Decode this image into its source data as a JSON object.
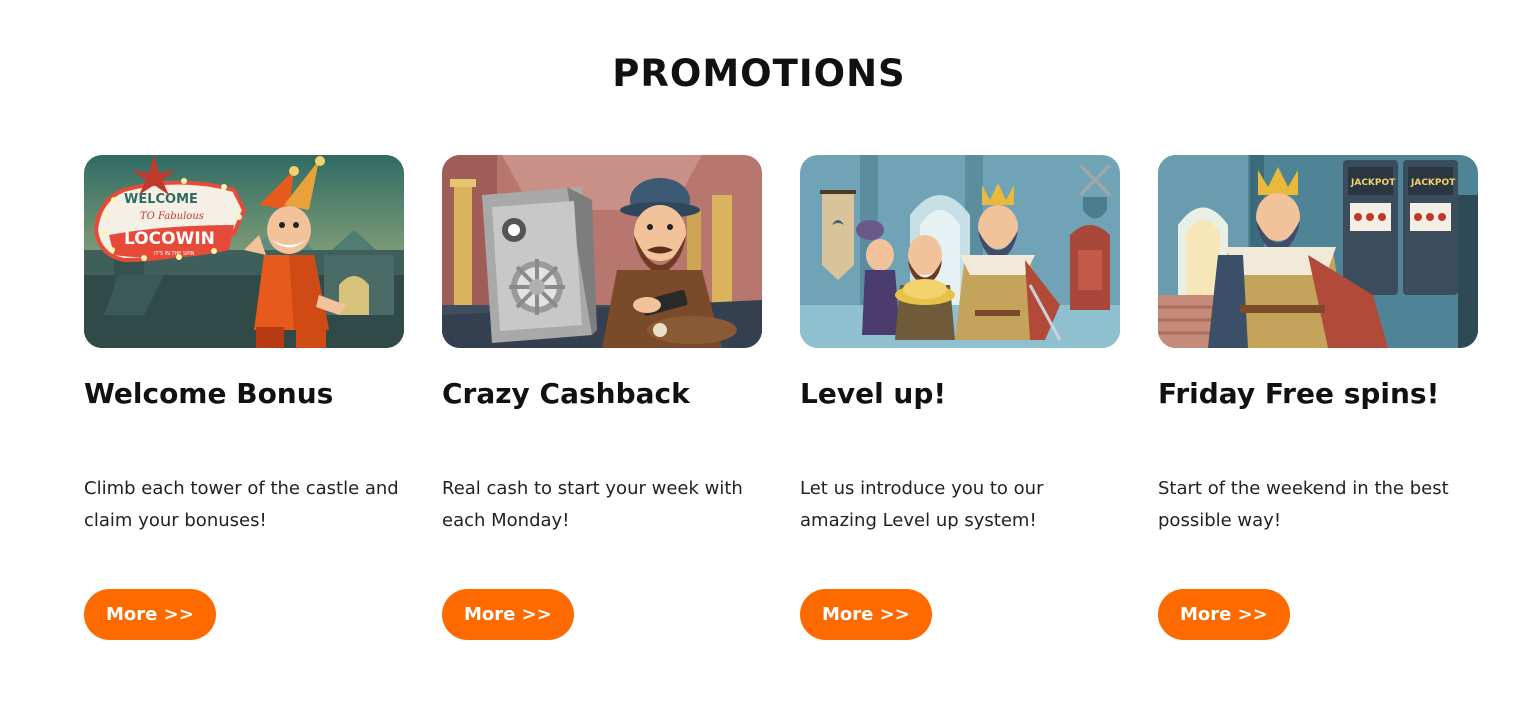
{
  "page": {
    "title": "PROMOTIONS"
  },
  "colors": {
    "accent": "#ff6a00",
    "text": "#111111",
    "background": "#ffffff"
  },
  "promotions": [
    {
      "title": "Welcome Bonus",
      "description": "Climb each tower of the castle and claim your bonuses!",
      "button_label": "More >>",
      "image": {
        "subject": "jester-welcome-sign-illustration",
        "sign_text": [
          "WELCOME",
          "TO Fabulous",
          "LOCOWIN",
          "IT'S IN THE SPIN"
        ]
      }
    },
    {
      "title": "Crazy Cashback",
      "description": "Real cash to start your week with each Monday!",
      "button_label": "More >>",
      "image": {
        "subject": "bearded-adventurer-with-safe-illustration"
      }
    },
    {
      "title": "Level up!",
      "description": "Let us introduce you to our amazing Level up system!",
      "button_label": "More >>",
      "image": {
        "subject": "king-jester-and-adventurer-in-throne-room-illustration"
      }
    },
    {
      "title": "Friday Free spins!",
      "description": "Start of the weekend in the best possible way!",
      "button_label": "More >>",
      "image": {
        "subject": "king-with-slot-machines-illustration",
        "slot_text": [
          "JACKPOT",
          "JACKPOT"
        ]
      }
    }
  ]
}
